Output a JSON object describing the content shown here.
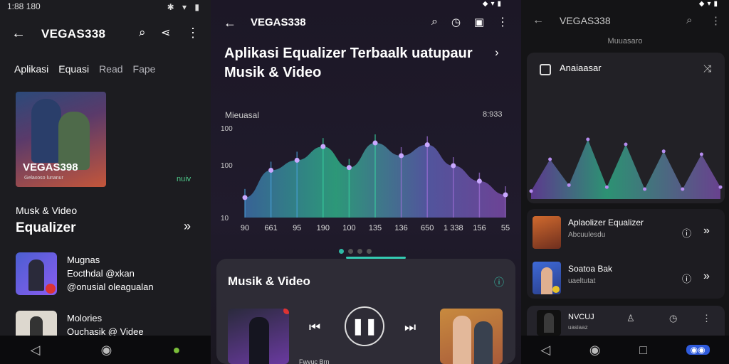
{
  "screen1": {
    "status_time": "1:88 180",
    "app_title": "VEGAS338",
    "tabs": [
      "Aplikasi",
      "Equasi",
      "Read",
      "Fape"
    ],
    "album_label": "VEGAS398",
    "album_sub": "Gelaxoso lunanur",
    "side_tag": "nuiv",
    "section_kicker": "Musk & Video",
    "section_title": "Equalizer",
    "list": [
      {
        "line1": "Mugnas",
        "line2": "Eocthdal @xkan",
        "line3": "@onusial oleagualan"
      },
      {
        "line1": "Molories",
        "line2": "Ouchasik @ Videe",
        "line3": ""
      }
    ]
  },
  "screen2": {
    "app_title": "VEGAS338",
    "headline_1": "Aplikasi Equalizer Terbaalk uatupaur",
    "headline_2": "Musik & Video",
    "chart_label": "Mieuasal",
    "chart_value": "8:933",
    "card_title": "Musik & Video",
    "track_left": "Fwvuc Brn"
  },
  "screen3": {
    "app_title": "VEGAS338",
    "subtitle": "Muuasaro",
    "card_title": "Anaiaasar",
    "list": [
      {
        "title": "Aplaolizer Equalizer",
        "sub": "Abcuulesdu"
      },
      {
        "title": "Soatoa Bak",
        "sub": "uaeltutat"
      }
    ],
    "mini_label": "NVCUJ",
    "mini_sub": "uasiaaz"
  },
  "chart_data": {
    "type": "area",
    "title": "",
    "xlabel": "",
    "ylabel": "",
    "categories": [
      "90",
      "661",
      "95",
      "190",
      "100",
      "135",
      "136",
      "650",
      "1 338",
      "156",
      "55"
    ],
    "y_ticks": [
      "10",
      "100",
      "100"
    ],
    "values": [
      22,
      52,
      63,
      78,
      55,
      82,
      68,
      80,
      57,
      40,
      25
    ]
  },
  "chart_data_small": {
    "type": "line",
    "values": [
      8,
      40,
      14,
      60,
      12,
      55,
      10,
      48,
      10,
      45,
      12
    ]
  }
}
